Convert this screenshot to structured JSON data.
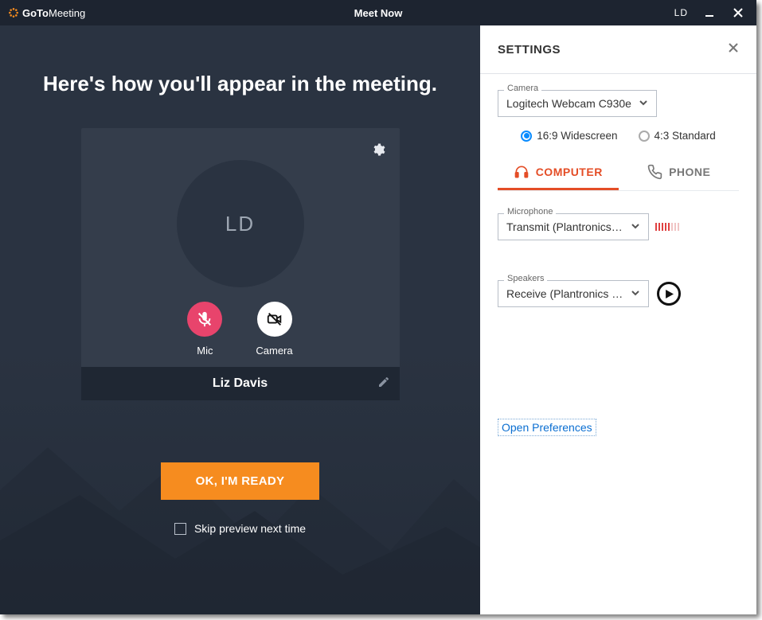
{
  "titlebar": {
    "brand_bold": "GoTo",
    "brand_light": "Meeting",
    "title": "Meet Now",
    "initials": "LD"
  },
  "preview": {
    "headline": "Here's how you'll appear in the meeting.",
    "avatar_initials": "LD",
    "mic_label": "Mic",
    "camera_label": "Camera",
    "display_name": "Liz Davis",
    "ready_button": "OK, I'M READY",
    "skip_label": "Skip preview next time",
    "skip_checked": false
  },
  "settings": {
    "heading": "SETTINGS",
    "camera_legend": "Camera",
    "camera_value": "Logitech Webcam C930e",
    "aspect_wide": "16:9 Widescreen",
    "aspect_std": "4:3 Standard",
    "aspect_selected": "wide",
    "tab_computer": "COMPUTER",
    "tab_phone": "PHONE",
    "mic_legend": "Microphone",
    "mic_value": "Transmit (Plantronics Savi...",
    "spk_legend": "Speakers",
    "spk_value": "Receive (Plantronics Savi ...",
    "prefs_link": "Open Preferences"
  }
}
